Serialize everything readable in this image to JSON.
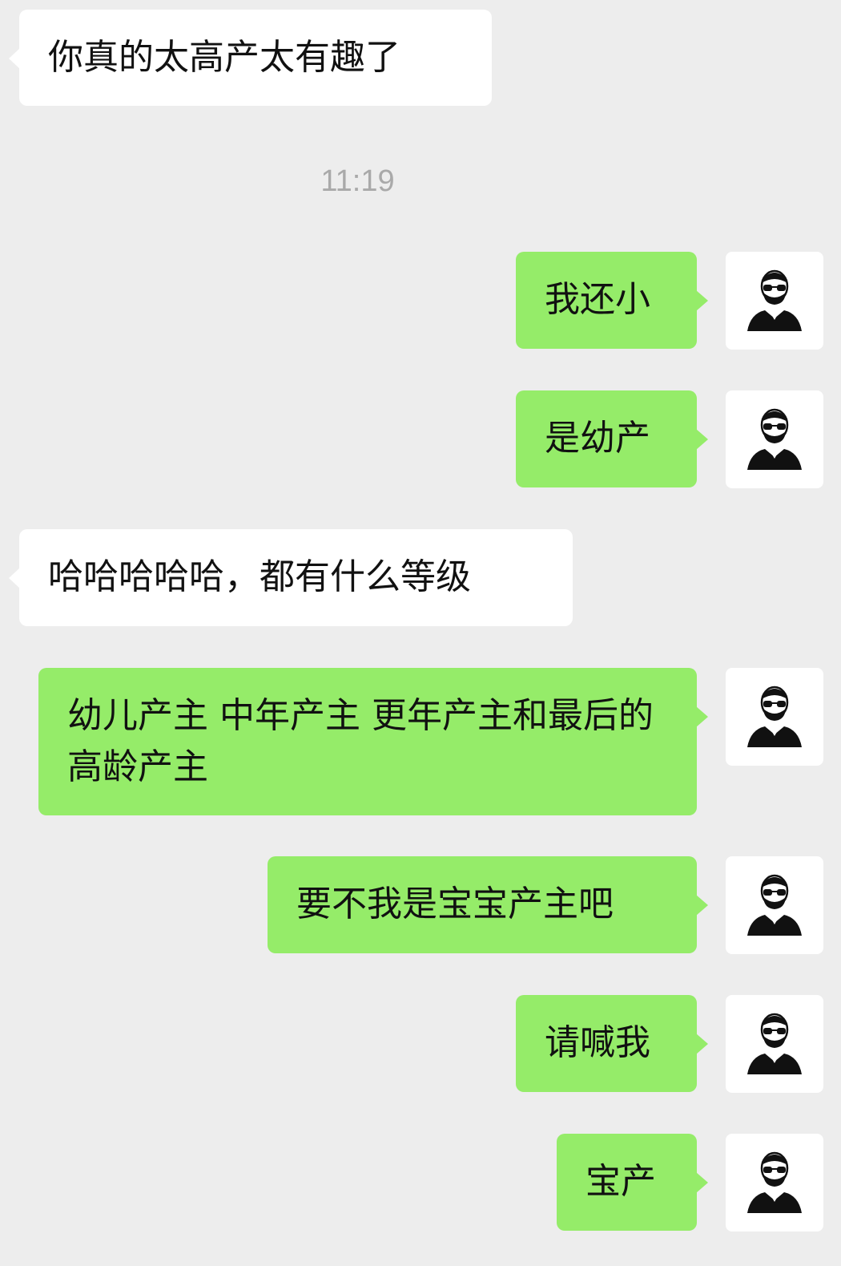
{
  "messages": [
    {
      "side": "left",
      "text": "你真的太高产太有趣了"
    },
    {
      "side": "right",
      "text": "我还小"
    },
    {
      "side": "right",
      "text": "是幼产"
    },
    {
      "side": "left",
      "text": "哈哈哈哈哈，都有什么等级"
    },
    {
      "side": "right",
      "text": "幼儿产主 中年产主 更年产主和最后的 高龄产主"
    },
    {
      "side": "right",
      "text": "要不我是宝宝产主吧"
    },
    {
      "side": "right",
      "text": "请喊我"
    },
    {
      "side": "right",
      "text": "宝产"
    }
  ],
  "timestamp": "11:19",
  "avatar_icon": "bearded-man-sunglasses-icon",
  "colors": {
    "background": "#ededed",
    "incoming_bubble": "#ffffff",
    "outgoing_bubble": "#95ec69",
    "timestamp": "#a9a9a9"
  }
}
